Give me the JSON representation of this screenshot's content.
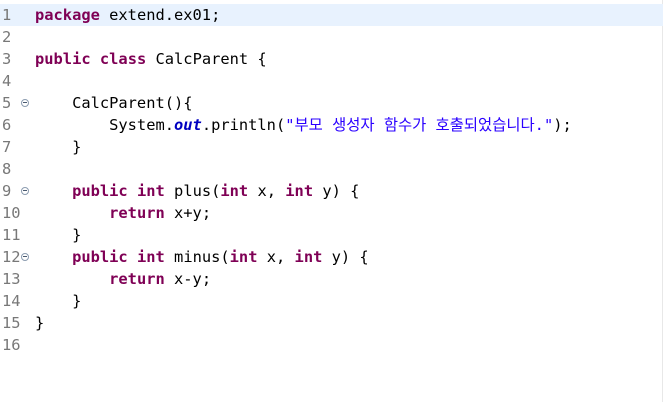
{
  "editor": {
    "line_numbers": [
      "1",
      "2",
      "3",
      "4",
      "5",
      "6",
      "7",
      "8",
      "9",
      "10",
      "11",
      "12",
      "13",
      "14",
      "15",
      "16"
    ],
    "line1": {
      "kw_package": "package",
      "rest": " extend.ex01;"
    },
    "line3": {
      "kw_public": "public",
      "sp1": " ",
      "kw_class": "class",
      "rest": " CalcParent {"
    },
    "line5": {
      "text": "    CalcParent(){"
    },
    "line6": {
      "pre": "        System.",
      "field_out": "out",
      "mid": ".println(",
      "string": "\"부모 생성자 함수가 호출되었습니다.\"",
      "post": ");"
    },
    "line7": {
      "text": "    }"
    },
    "line9": {
      "indent": "    ",
      "kw_public": "public",
      "sp1": " ",
      "kw_int": "int",
      "mid1": " plus(",
      "kw_int2": "int",
      "mid2": " x, ",
      "kw_int3": "int",
      "post": " y) {"
    },
    "line10": {
      "indent": "        ",
      "kw_return": "return",
      "rest": " x+y;"
    },
    "line11": {
      "text": "    }"
    },
    "line12": {
      "indent": "    ",
      "kw_public": "public",
      "sp1": " ",
      "kw_int": "int",
      "mid1": " minus(",
      "kw_int2": "int",
      "mid2": " x, ",
      "kw_int3": "int",
      "post": " y) {"
    },
    "line13": {
      "indent": "        ",
      "kw_return": "return",
      "rest": " x-y;"
    },
    "line14": {
      "text": "    }"
    },
    "line15": {
      "text": "}"
    }
  },
  "colors": {
    "keyword": "#7f0055",
    "field": "#0000c0",
    "string": "#2a00ff",
    "line_number": "#787878",
    "current_line": "#e8f2fe"
  },
  "icons": [
    "fold-collapse-icon"
  ]
}
